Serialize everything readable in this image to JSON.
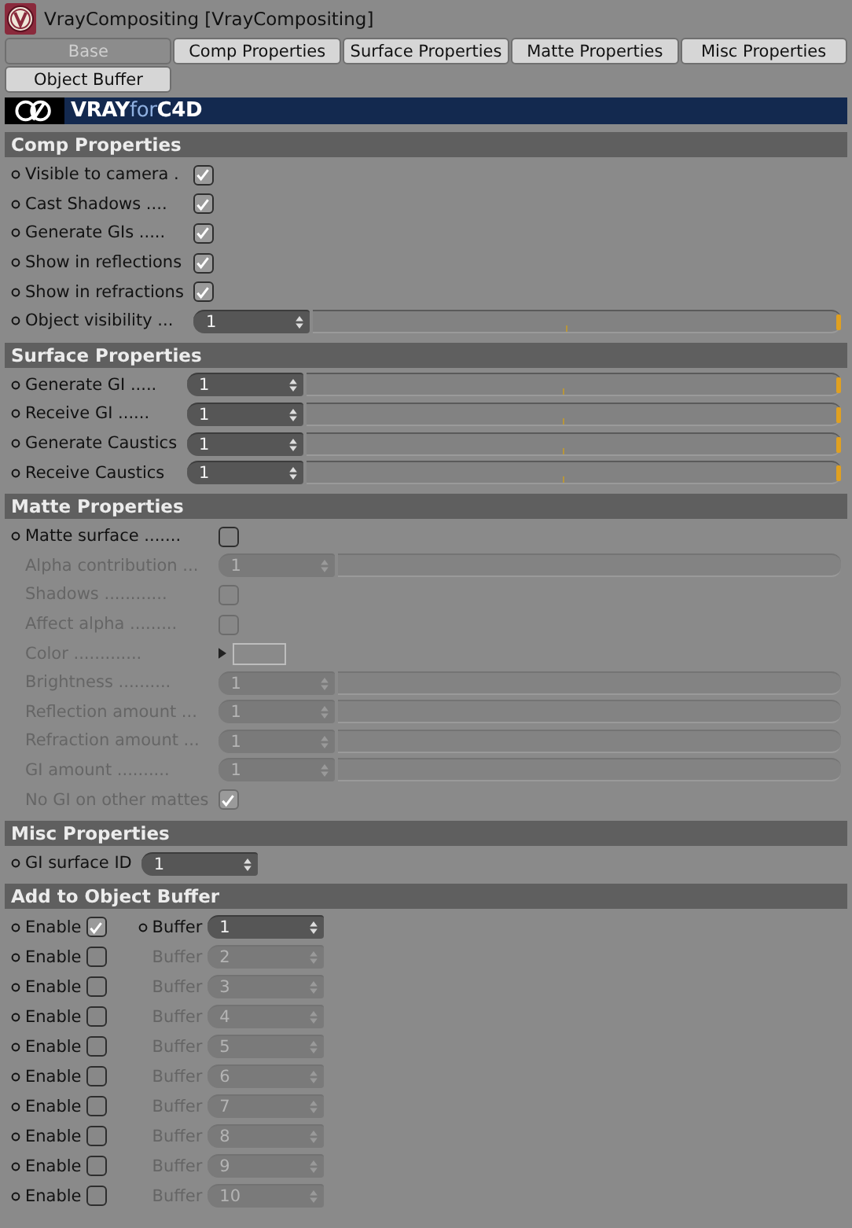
{
  "window": {
    "title": "VrayCompositing [VrayCompositing]"
  },
  "tabs": [
    {
      "label": "Base",
      "selected": true
    },
    {
      "label": "Comp Properties",
      "selected": false
    },
    {
      "label": "Surface Properties",
      "selected": false
    },
    {
      "label": "Matte Properties",
      "selected": false
    },
    {
      "label": "Misc Properties",
      "selected": false
    },
    {
      "label": "Object Buffer",
      "selected": false
    }
  ],
  "banner": {
    "logo": "**VRAY**for**C4D**"
  },
  "sections": [
    {
      "title": "Comp Properties",
      "rows": [
        {
          "kind": "checkbox",
          "label": "Visible to camera .",
          "checked": true,
          "disabled": false
        },
        {
          "kind": "checkbox",
          "label": "Cast Shadows ....",
          "checked": true,
          "disabled": false
        },
        {
          "kind": "checkbox",
          "label": "Generate GIs .....",
          "checked": true,
          "disabled": false
        },
        {
          "kind": "checkbox",
          "label": "Show in reflections",
          "checked": true,
          "disabled": false
        },
        {
          "kind": "checkbox",
          "label": "Show in refractions",
          "checked": true,
          "disabled": false
        },
        {
          "kind": "slider",
          "label": "Object visibility ...",
          "value": "1",
          "level": 1,
          "disabled": false
        }
      ]
    },
    {
      "title": "Surface Properties",
      "rows": [
        {
          "kind": "slider",
          "label": "Generate GI .....",
          "value": "1",
          "level": 1,
          "disabled": false
        },
        {
          "kind": "slider",
          "label": "Receive GI ......",
          "value": "1",
          "level": 1,
          "disabled": false
        },
        {
          "kind": "slider",
          "label": "Generate Caustics",
          "value": "1",
          "level": 1,
          "disabled": false
        },
        {
          "kind": "slider",
          "label": "Receive Caustics",
          "value": "1",
          "level": 1,
          "disabled": false
        }
      ]
    },
    {
      "title": "Matte Properties",
      "rows": [
        {
          "kind": "checkbox",
          "label": "Matte surface .......",
          "checked": false,
          "disabled": false
        },
        {
          "kind": "slider",
          "label": "Alpha contribution ...",
          "value": "1",
          "disabled": true
        },
        {
          "kind": "checkbox",
          "label": "Shadows ............",
          "checked": false,
          "disabled": true
        },
        {
          "kind": "checkbox",
          "label": "Affect alpha .........",
          "checked": false,
          "disabled": true
        },
        {
          "kind": "color",
          "label": "Color .............",
          "expanded": false,
          "disabled": true
        },
        {
          "kind": "slider",
          "label": "Brightness ..........",
          "value": "1",
          "disabled": true
        },
        {
          "kind": "slider",
          "label": "Reflection amount ...",
          "value": "1",
          "disabled": true
        },
        {
          "kind": "slider",
          "label": "Refraction amount ...",
          "value": "1",
          "disabled": true
        },
        {
          "kind": "slider",
          "label": "GI amount ..........",
          "value": "1",
          "disabled": true
        },
        {
          "kind": "checkbox",
          "label": "No GI on other mattes",
          "checked": true,
          "disabled": true
        }
      ]
    },
    {
      "title": "Misc Properties",
      "rows": [
        {
          "kind": "number",
          "label": "GI surface ID",
          "value": "1",
          "disabled": false
        }
      ]
    }
  ],
  "object_buffer": {
    "title": "Add to Object Buffer",
    "rows": [
      {
        "enable_label": "Enable",
        "checked": true,
        "buffer_label": "Buffer",
        "value": "1",
        "disabled": false
      },
      {
        "enable_label": "Enable",
        "checked": false,
        "buffer_label": "Buffer",
        "value": "2",
        "disabled": true
      },
      {
        "enable_label": "Enable",
        "checked": false,
        "buffer_label": "Buffer",
        "value": "3",
        "disabled": true
      },
      {
        "enable_label": "Enable",
        "checked": false,
        "buffer_label": "Buffer",
        "value": "4",
        "disabled": true
      },
      {
        "enable_label": "Enable",
        "checked": false,
        "buffer_label": "Buffer",
        "value": "5",
        "disabled": true
      },
      {
        "enable_label": "Enable",
        "checked": false,
        "buffer_label": "Buffer",
        "value": "6",
        "disabled": true
      },
      {
        "enable_label": "Enable",
        "checked": false,
        "buffer_label": "Buffer",
        "value": "7",
        "disabled": true
      },
      {
        "enable_label": "Enable",
        "checked": false,
        "buffer_label": "Buffer",
        "value": "8",
        "disabled": true
      },
      {
        "enable_label": "Enable",
        "checked": false,
        "buffer_label": "Buffer",
        "value": "9",
        "disabled": true
      },
      {
        "enable_label": "Enable",
        "checked": false,
        "buffer_label": "Buffer",
        "value": "10",
        "disabled": true
      }
    ]
  }
}
